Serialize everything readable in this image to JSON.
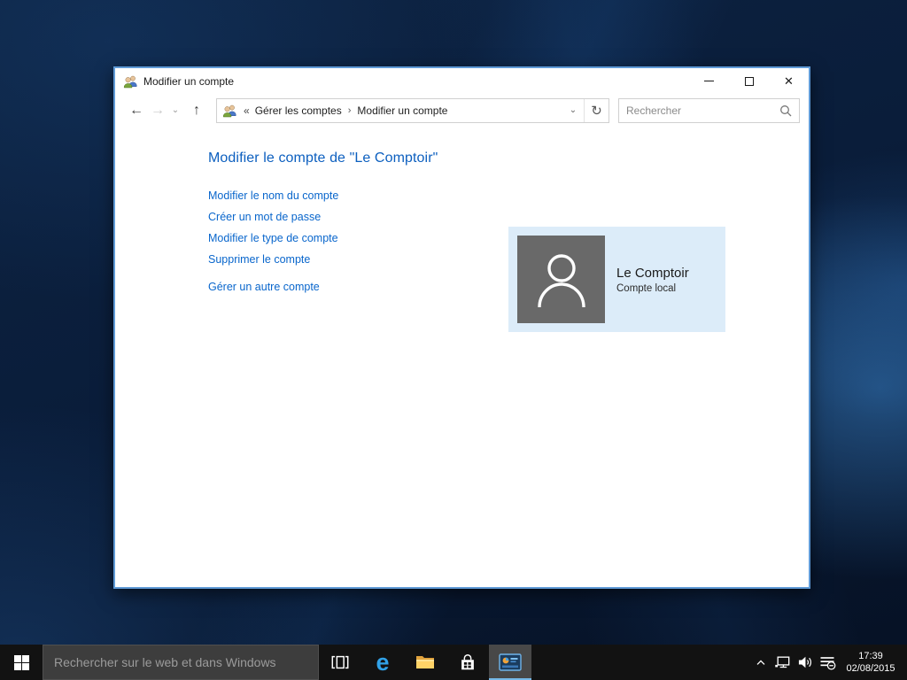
{
  "window": {
    "title": "Modifier un compte",
    "breadcrumb": {
      "guillemet": "«",
      "separator": "›",
      "items": [
        {
          "label": "Gérer les comptes"
        },
        {
          "label": "Modifier un compte"
        }
      ]
    },
    "toolbar_icons": {
      "back": "←",
      "forward": "→",
      "drop": "⌄",
      "up": "↑",
      "addr_drop": "⌄",
      "refresh": "↻"
    },
    "caption_icons": {
      "close": "✕"
    },
    "search_placeholder": "Rechercher",
    "content": {
      "heading": "Modifier le compte de \"Le Comptoir\"",
      "links": [
        "Modifier le nom du compte",
        "Créer un mot de passe",
        "Modifier le type de compte",
        "Supprimer le compte",
        "Gérer un autre compte"
      ],
      "tile": {
        "name": "Le Comptoir",
        "type": "Compte local"
      }
    }
  },
  "taskbar": {
    "search_placeholder": "Rechercher sur le web et dans Windows",
    "clock": {
      "time": "17:39",
      "date": "02/08/2015"
    }
  },
  "colors": {
    "window_border": "#5f9ad6",
    "heading_blue": "#0c5fbf",
    "link_blue": "#0966cc",
    "tile_bg": "#dcecf9",
    "avatar_gray": "#696969",
    "taskbar_bg": "#121212",
    "active_underline": "#76b9e8"
  }
}
